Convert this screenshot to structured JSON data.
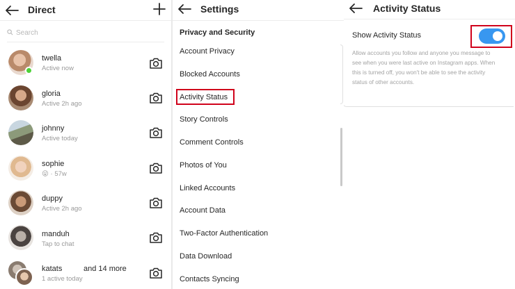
{
  "direct": {
    "title": "Direct",
    "search_placeholder": "Search",
    "conversations": [
      {
        "name": "twella",
        "status": "Active now",
        "extra": "",
        "online": true
      },
      {
        "name": "gloria",
        "status": "Active 2h ago",
        "extra": ""
      },
      {
        "name": "johnny",
        "status": "Active today",
        "extra": ""
      },
      {
        "name": "sophie",
        "status": "😜 · 57w",
        "extra": ""
      },
      {
        "name": "duppy",
        "status": "Active 2h ago",
        "extra": ""
      },
      {
        "name": "manduh",
        "status": "Tap to chat",
        "extra": ""
      },
      {
        "name": "katats",
        "status": "1 active today",
        "extra": "and 14 more"
      }
    ]
  },
  "settings": {
    "title": "Settings",
    "section": "Privacy and Security",
    "items": [
      "Account Privacy",
      "Blocked Accounts",
      "Activity Status",
      "Story Controls",
      "Comment Controls",
      "Photos of You",
      "Linked Accounts",
      "Account Data",
      "Two-Factor Authentication",
      "Data Download",
      "Contacts Syncing"
    ],
    "highlighted_item": "Activity Status"
  },
  "activity": {
    "title": "Activity Status",
    "toggle_label": "Show Activity Status",
    "toggle_on": true,
    "description": "Allow accounts you follow and anyone you message to see when you were last active on Instagram apps. When this is turned off, you won't be able to see the activity status of other accounts."
  },
  "colors": {
    "toggle_on": "#3897f0",
    "online_dot": "#4cd137",
    "highlight_box": "#d0021b"
  }
}
